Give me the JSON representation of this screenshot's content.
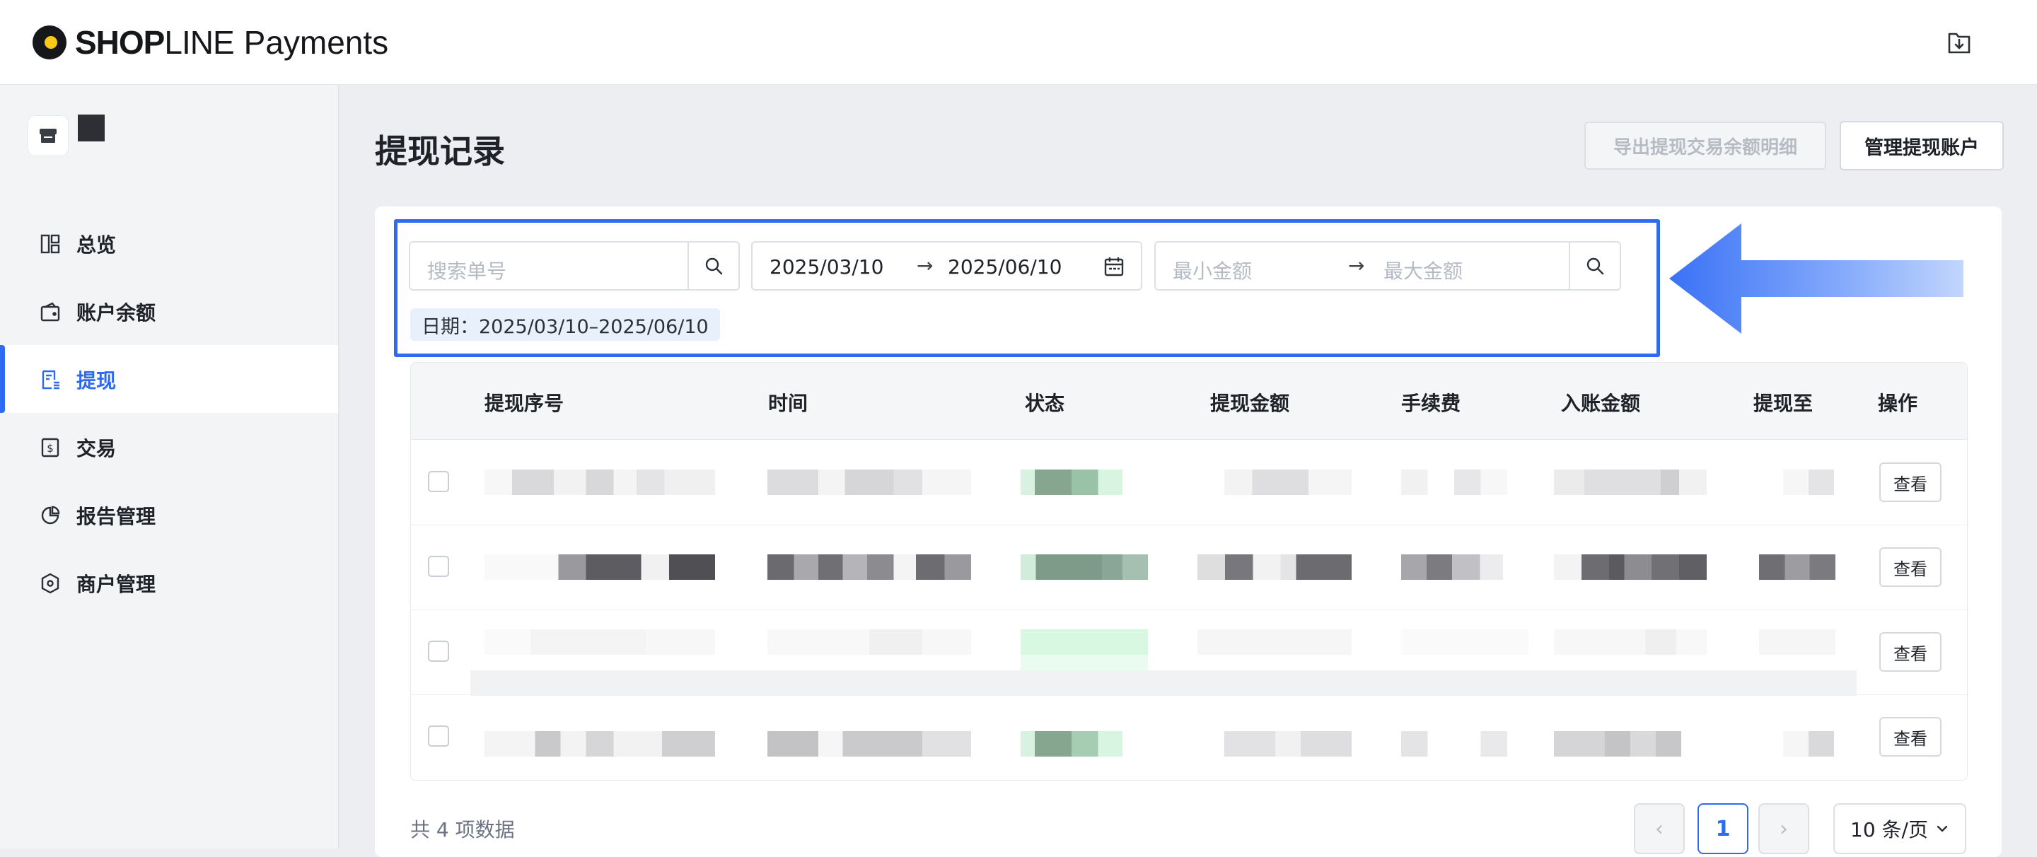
{
  "brand": {
    "shop": "SHOP",
    "line": "LINE",
    "payments": "Payments"
  },
  "icons": {
    "download": "download-icon",
    "store": "store-icon",
    "search": "search-icon",
    "calendar": "calendar-icon",
    "arrow": "arrow-left-annotation"
  },
  "sidebar": {
    "items": [
      {
        "label": "总览",
        "icon": "dashboard-icon"
      },
      {
        "label": "账户余额",
        "icon": "wallet-icon"
      },
      {
        "label": "提现",
        "icon": "withdraw-doc-icon",
        "active": true
      },
      {
        "label": "交易",
        "icon": "transaction-icon"
      },
      {
        "label": "报告管理",
        "icon": "report-pie-icon"
      },
      {
        "label": "商户管理",
        "icon": "merchant-hex-icon"
      }
    ]
  },
  "main": {
    "title": "提现记录",
    "export_label": "导出提现交易余额明细",
    "manage_label": "管理提现账户"
  },
  "filters": {
    "search_placeholder": "搜索单号",
    "date_start": "2025/03/10",
    "date_end": "2025/06/10",
    "range_arrow": "→",
    "min_amount_placeholder": "最小金额",
    "max_amount_placeholder": "最大金额",
    "date_tag": "日期：2025/03/10–2025/06/10"
  },
  "table": {
    "columns": [
      "提现序号",
      "时间",
      "状态",
      "提现金额",
      "手续费",
      "入账金额",
      "提现至",
      "操作"
    ],
    "row_action": "查看",
    "row_count": 4
  },
  "pagination": {
    "total_text": "共 4 项数据",
    "prev": "‹",
    "current": "1",
    "next": "›",
    "page_size": "10 条/页"
  },
  "colors": {
    "accent": "#2f6bf0",
    "annotation": "#3d76f7"
  }
}
